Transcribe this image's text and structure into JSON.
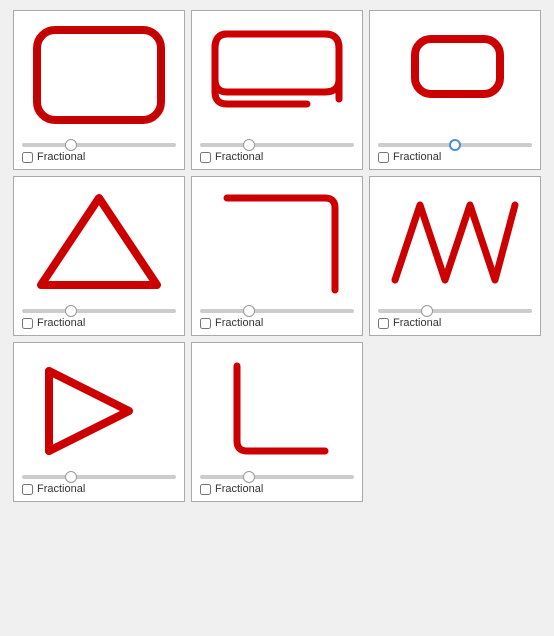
{
  "cards": [
    {
      "id": "rounded-rect-full",
      "label": "Fractional",
      "sliderValue": 30,
      "sliderBlue": false
    },
    {
      "id": "rounded-rect-partial",
      "label": "Fractional",
      "sliderValue": 30,
      "sliderBlue": false
    },
    {
      "id": "rounded-rect-small",
      "label": "Fractional",
      "sliderValue": 50,
      "sliderBlue": true
    },
    {
      "id": "triangle",
      "label": "Fractional",
      "sliderValue": 30,
      "sliderBlue": false
    },
    {
      "id": "curve",
      "label": "Fractional",
      "sliderValue": 30,
      "sliderBlue": false
    },
    {
      "id": "zigzag",
      "label": "Fractional",
      "sliderValue": 30,
      "sliderBlue": false
    },
    {
      "id": "arrow",
      "label": "Fractional",
      "sliderValue": 30,
      "sliderBlue": false
    },
    {
      "id": "corner",
      "label": "Fractional",
      "sliderValue": 30,
      "sliderBlue": false
    }
  ]
}
